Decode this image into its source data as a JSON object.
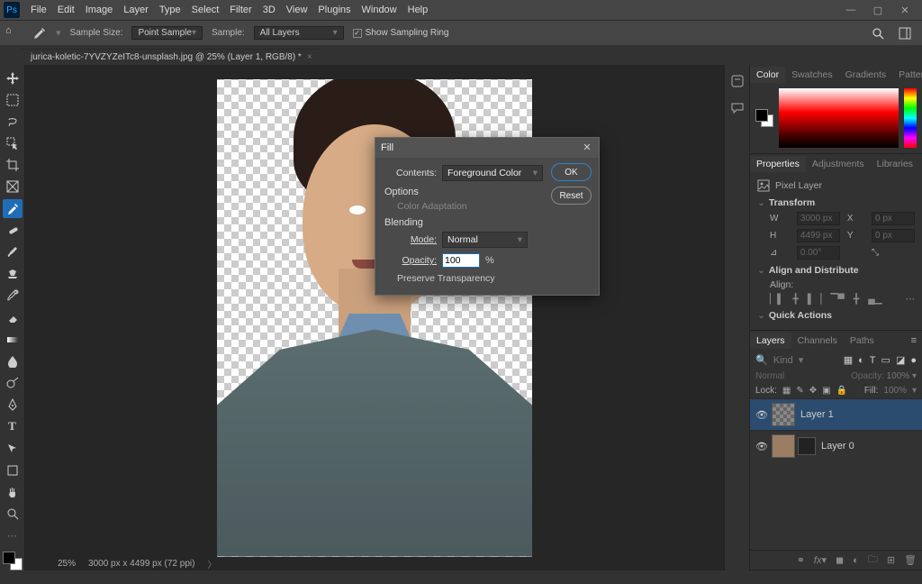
{
  "app": {
    "ps_label": "Ps"
  },
  "menu": [
    "File",
    "Edit",
    "Image",
    "Layer",
    "Type",
    "Select",
    "Filter",
    "3D",
    "View",
    "Plugins",
    "Window",
    "Help"
  ],
  "options_bar": {
    "sample_size_label": "Sample Size:",
    "sample_size_value": "Point Sample",
    "sample_label": "Sample:",
    "sample_value": "All Layers",
    "show_sampling_ring": "Show Sampling Ring"
  },
  "document_tab": "jurica-koletic-7YVZYZeITc8-unsplash.jpg @ 25% (Layer 1, RGB/8) *",
  "fill_dialog": {
    "title": "Fill",
    "contents_label": "Contents:",
    "contents_value": "Foreground Color",
    "ok": "OK",
    "reset": "Reset",
    "options_label": "Options",
    "color_adaptation": "Color Adaptation",
    "blending_label": "Blending",
    "mode_label": "Mode:",
    "mode_value": "Normal",
    "opacity_label": "Opacity:",
    "opacity_value": "100",
    "opacity_unit": "%",
    "preserve_transparency": "Preserve Transparency"
  },
  "color_panel": {
    "tabs": [
      "Color",
      "Swatches",
      "Gradients",
      "Patterns"
    ]
  },
  "properties_panel": {
    "tabs": [
      "Properties",
      "Adjustments",
      "Libraries"
    ],
    "pixel_layer": "Pixel Layer",
    "transform": "Transform",
    "w_label": "W",
    "w_value": "3000 px",
    "h_label": "H",
    "h_value": "4499 px",
    "x_label": "X",
    "x_value": "0 px",
    "y_label": "Y",
    "y_value": "0 px",
    "angle_value": "0.00°",
    "align_distribute": "Align and Distribute",
    "align_label": "Align:",
    "quick_actions": "Quick Actions"
  },
  "layers_panel": {
    "tabs": [
      "Layers",
      "Channels",
      "Paths"
    ],
    "kind_placeholder": "Kind",
    "blend_mode": "Normal",
    "opacity_label": "Opacity:",
    "opacity_value": "100%",
    "lock_label": "Lock:",
    "fill_label": "Fill:",
    "fill_value": "100%",
    "layers": [
      {
        "name": "Layer 1",
        "selected": true,
        "mask": false
      },
      {
        "name": "Layer 0",
        "selected": false,
        "mask": true
      }
    ]
  },
  "status": {
    "zoom": "25%",
    "dimensions": "3000 px x 4499 px (72 ppi)"
  }
}
